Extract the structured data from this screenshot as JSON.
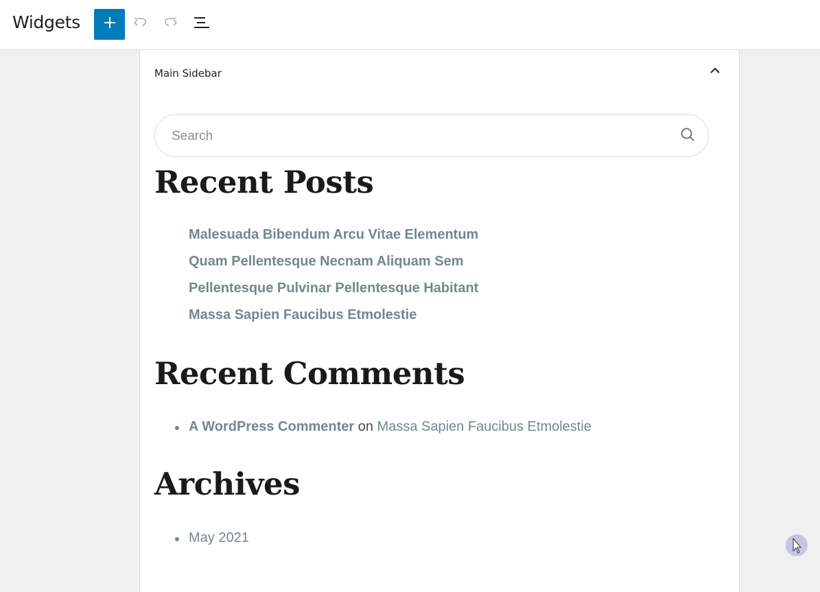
{
  "header": {
    "title": "Widgets",
    "add_icon": "plus-icon",
    "undo_icon": "undo-icon",
    "redo_icon": "redo-icon",
    "list_view_icon": "list-view-icon",
    "accent_color": "#007cba"
  },
  "widget_area": {
    "title": "Main Sidebar",
    "toggle_icon": "chevron-up-icon"
  },
  "search": {
    "placeholder": "Search",
    "value": "",
    "icon": "search-icon"
  },
  "recent_posts": {
    "heading": "Recent Posts",
    "items": [
      "Malesuada Bibendum Arcu Vitae Elementum",
      "Quam Pellentesque Necnam Aliquam Sem",
      "Pellentesque Pulvinar Pellentesque Habitant",
      "Massa Sapien Faucibus Etmolestie"
    ]
  },
  "recent_comments": {
    "heading": "Recent Comments",
    "items": [
      {
        "author": "A WordPress Commenter",
        "connector": "on",
        "post": "Massa Sapien Faucibus Etmolestie"
      }
    ]
  },
  "archives": {
    "heading": "Archives",
    "items": [
      "May 2021"
    ]
  },
  "colors": {
    "link": "#75878a",
    "heading": "#1a1a1a",
    "background": "#f0f0f1"
  }
}
